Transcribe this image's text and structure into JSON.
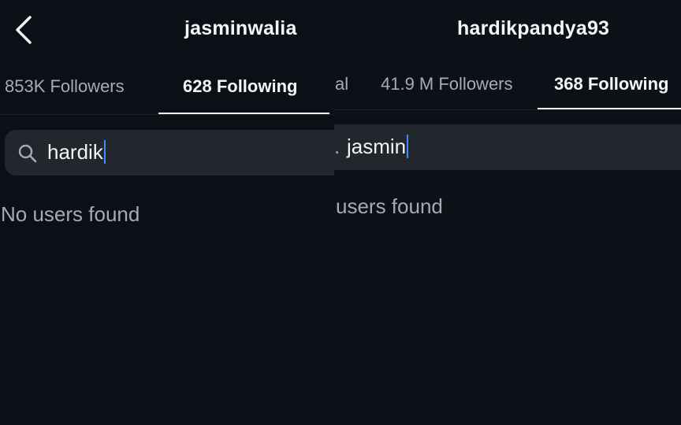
{
  "left_panel": {
    "username": "jasminwalia",
    "tabs": {
      "followers_label": "853K Followers",
      "following_label": "628 Following"
    },
    "search": {
      "value": "hardik"
    },
    "empty_message": "No users found",
    "icons": [
      "chevron-left-icon",
      "search-icon"
    ]
  },
  "right_panel": {
    "username": "hardikpandya93",
    "tabs": {
      "clipped_label": "al",
      "followers_label": "41.9 M Followers",
      "following_label": "368 Following"
    },
    "search": {
      "clipped_prefix": ".",
      "value": "jasmin"
    },
    "empty_message": "users found"
  },
  "colors": {
    "background": "#0c0f15",
    "search_background": "#22262d",
    "active_text": "#f4f5f7",
    "inactive_text": "#a7acb4",
    "caret": "#3d8bff"
  }
}
